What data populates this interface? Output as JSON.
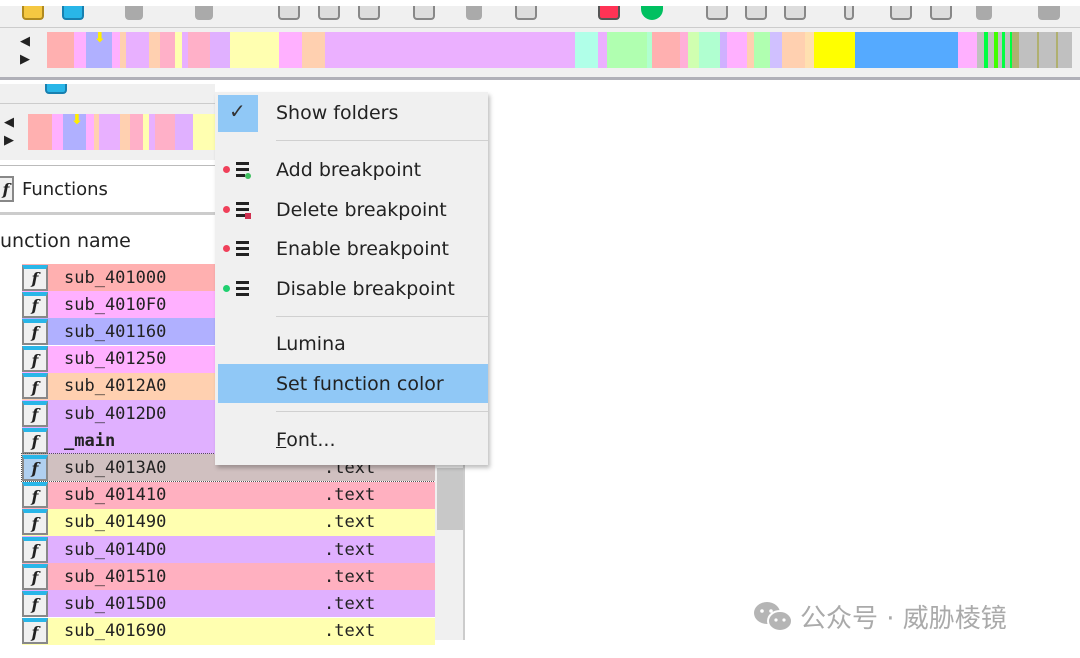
{
  "functions_panel": {
    "title": "Functions",
    "column_header": "unction name",
    "rows": [
      {
        "name": "sub_401000",
        "segment": "",
        "color": "#ffb0b0"
      },
      {
        "name": "sub_4010F0",
        "segment": "",
        "color": "#ffb0ff"
      },
      {
        "name": "sub_401160",
        "segment": "",
        "color": "#b0b0ff"
      },
      {
        "name": "sub_401250",
        "segment": "",
        "color": "#ffb0ff"
      },
      {
        "name": "sub_4012A0",
        "segment": "",
        "color": "#ffd0b0"
      },
      {
        "name": "sub_4012D0",
        "segment": "",
        "color": "#e0b0ff"
      },
      {
        "name": "_main",
        "segment": "",
        "color": "#e0b0ff",
        "bold": true
      },
      {
        "name": "sub_4013A0",
        "segment": ".text",
        "color": "#d0c0c0",
        "selected": true
      },
      {
        "name": "sub_401410",
        "segment": ".text",
        "color": "#ffb0c0"
      },
      {
        "name": "sub_401490",
        "segment": ".text",
        "color": "#ffffb0"
      },
      {
        "name": "sub_4014D0",
        "segment": ".text",
        "color": "#e0b0ff"
      },
      {
        "name": "sub_401510",
        "segment": ".text",
        "color": "#ffb0c0"
      },
      {
        "name": "sub_4015D0",
        "segment": ".text",
        "color": "#e0b0ff"
      },
      {
        "name": "sub_401690",
        "segment": ".text",
        "color": "#ffffb0"
      }
    ]
  },
  "context_menu": {
    "items": [
      {
        "label": "Show folders",
        "checked": true,
        "icon": "check-icon"
      },
      {
        "label": "Add breakpoint",
        "icon": "add-breakpoint-icon"
      },
      {
        "label": "Delete breakpoint",
        "icon": "delete-breakpoint-icon"
      },
      {
        "label": "Enable breakpoint",
        "icon": "enable-breakpoint-icon"
      },
      {
        "label": "Disable breakpoint",
        "icon": "disable-breakpoint-icon"
      },
      {
        "label": "Lumina"
      },
      {
        "label": "Set function color",
        "highlighted": true
      },
      {
        "label": "Font..."
      }
    ]
  },
  "watermark": {
    "text": "公众号 · 威胁棱镜",
    "icon": "wechat-icon"
  },
  "colors": {
    "menu_highlight": "#90c8f6",
    "toolbar": "#f0f0f0"
  }
}
